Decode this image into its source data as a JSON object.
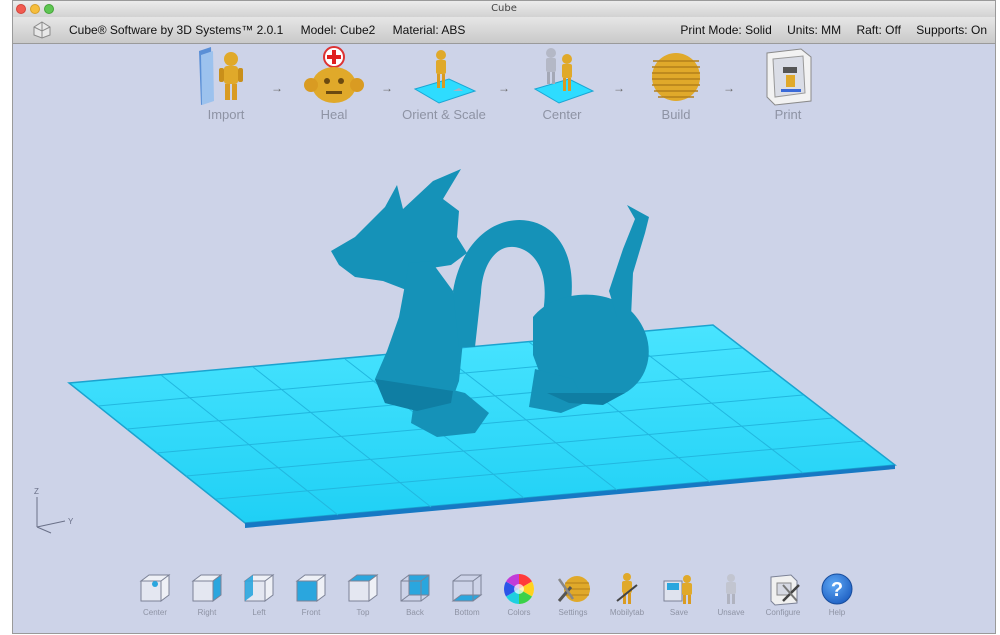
{
  "window": {
    "title": "Cube"
  },
  "infobar": {
    "software": "Cube® Software by 3D Systems™ 2.0.1",
    "model": "Model: Cube2",
    "material": "Material: ABS",
    "print_mode": "Print Mode: Solid",
    "units": "Units: MM",
    "raft": "Raft: Off",
    "supports": "Supports: On"
  },
  "workflow": {
    "steps": [
      {
        "label": "Import",
        "icon": "folder-figure-icon"
      },
      {
        "label": "Heal",
        "icon": "medic-head-icon"
      },
      {
        "label": "Orient & Scale",
        "icon": "figure-on-plate-icon"
      },
      {
        "label": "Center",
        "icon": "figures-center-icon"
      },
      {
        "label": "Build",
        "icon": "layered-head-icon"
      },
      {
        "label": "Print",
        "icon": "printer-icon"
      }
    ],
    "arrow": "→"
  },
  "viewport": {
    "model_color": "#1592b8",
    "plate_color": "#2edcff",
    "axis_labels": {
      "z": "Z",
      "y": "Y"
    }
  },
  "toolbar": {
    "items": [
      {
        "label": "Center",
        "icon": "view-center-cube-icon"
      },
      {
        "label": "Right",
        "icon": "view-right-cube-icon"
      },
      {
        "label": "Left",
        "icon": "view-left-cube-icon"
      },
      {
        "label": "Front",
        "icon": "view-front-cube-icon"
      },
      {
        "label": "Top",
        "icon": "view-top-cube-icon"
      },
      {
        "label": "Back",
        "icon": "view-back-cube-icon"
      },
      {
        "label": "Bottom",
        "icon": "view-bottom-cube-icon"
      },
      {
        "label": "Colors",
        "icon": "color-wheel-icon"
      },
      {
        "label": "Settings",
        "icon": "settings-tools-icon"
      },
      {
        "label": "Mobilytab",
        "icon": "figure-tool-icon"
      },
      {
        "label": "Save",
        "icon": "save-figure-icon"
      },
      {
        "label": "Unsave",
        "icon": "unsave-figure-icon"
      },
      {
        "label": "Configure",
        "icon": "configure-printer-icon"
      },
      {
        "label": "Help",
        "icon": "help-icon"
      }
    ]
  },
  "colors": {
    "background": "#cdd3e8",
    "model": "#1592b8",
    "plate": "#2edcff",
    "icon_gold": "#e0a92a",
    "label_gray": "#8e93a4",
    "help_blue": "#1e6fd0"
  }
}
